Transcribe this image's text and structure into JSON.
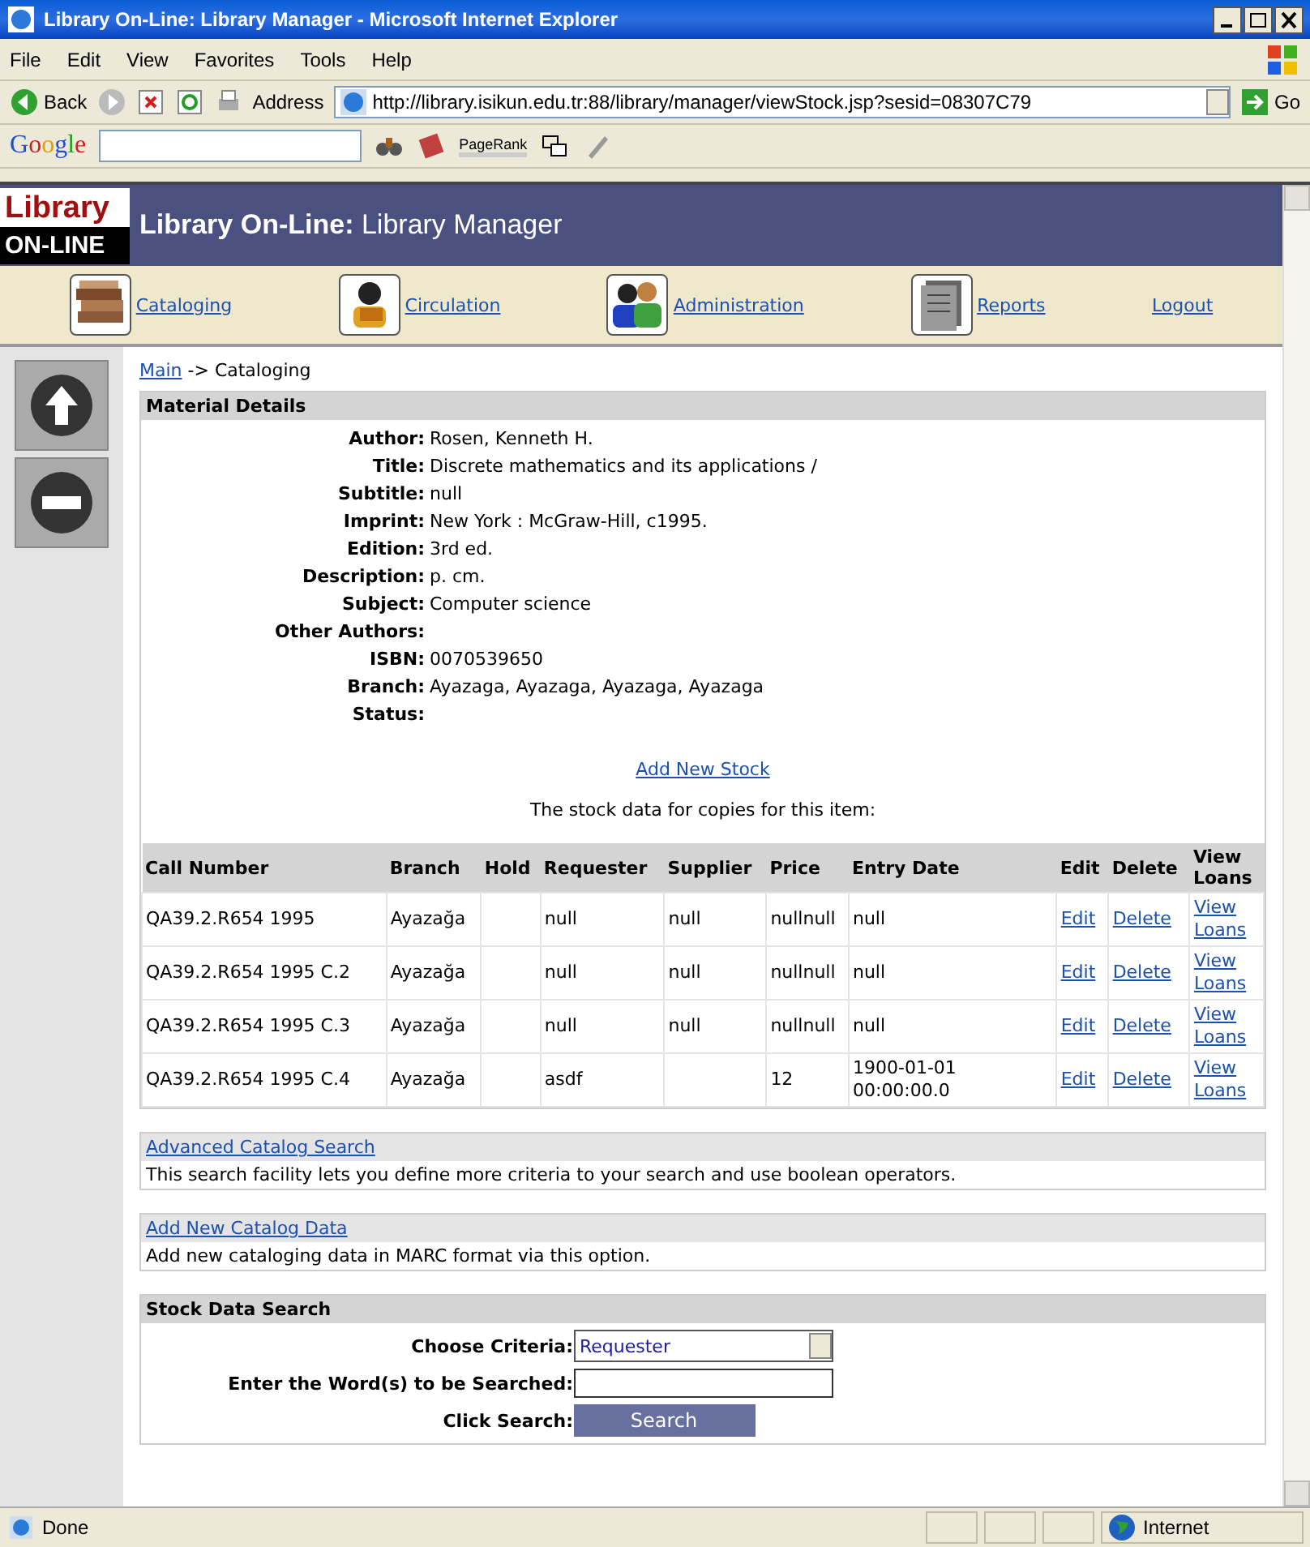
{
  "window": {
    "title": "Library On-Line: Library Manager - Microsoft Internet Explorer"
  },
  "menu": [
    "File",
    "Edit",
    "View",
    "Favorites",
    "Tools",
    "Help"
  ],
  "toolbar": {
    "back": "Back",
    "address_label": "Address",
    "url": "http://library.isikun.edu.tr:88/library/manager/viewStock.jsp?sesid=08307C79",
    "go": "Go"
  },
  "google_bar": {
    "logo": "Google",
    "pagerank": "PageRank"
  },
  "header": {
    "logo_top": "Library",
    "logo_bottom": "ON-LINE",
    "title_bold": "Library On-Line:",
    "title": "Library Manager"
  },
  "nav": [
    {
      "label": "Cataloging",
      "kind": "books"
    },
    {
      "label": "Circulation",
      "kind": "reader"
    },
    {
      "label": "Administration",
      "kind": "people"
    },
    {
      "label": "Reports",
      "kind": "document"
    },
    {
      "label": "Logout",
      "kind": "plain"
    }
  ],
  "breadcrumb": {
    "link": "Main",
    "rest": "-> Cataloging"
  },
  "material": {
    "heading": "Material Details",
    "fields": [
      {
        "label": "Author:",
        "value": "Rosen, Kenneth H."
      },
      {
        "label": "Title:",
        "value": "Discrete mathematics and its applications /"
      },
      {
        "label": "Subtitle:",
        "value": "null"
      },
      {
        "label": "Imprint:",
        "value": "New York : McGraw-Hill, c1995."
      },
      {
        "label": "Edition:",
        "value": "3rd ed."
      },
      {
        "label": "Description:",
        "value": "p. cm."
      },
      {
        "label": "Subject:",
        "value": "Computer science"
      },
      {
        "label": "Other Authors:"
      },
      {
        "label": "ISBN:",
        "value": "0070539650"
      },
      {
        "label": "Branch:",
        "value": "Ayazaga, Ayazaga, Ayazaga, Ayazaga"
      },
      {
        "label": "Status:"
      }
    ],
    "add_stock": "Add New Stock",
    "stock_note": "The stock data for copies for this item:"
  },
  "stock_table": {
    "columns": [
      "Call Number",
      "Branch",
      "Hold",
      "Requester",
      "Supplier",
      "Price",
      "Entry Date",
      "Edit",
      "Delete",
      "View Loans"
    ],
    "rows": [
      {
        "call_number": "QA39.2.R654 1995",
        "branch": "Ayazağa",
        "requester": "null",
        "supplier": "null",
        "price": "nullnull",
        "entry_date": "null",
        "actions": [
          "Edit",
          "Delete",
          "View Loans"
        ]
      },
      {
        "call_number": "QA39.2.R654 1995 C.2",
        "branch": "Ayazağa",
        "requester": "null",
        "supplier": "null",
        "price": "nullnull",
        "entry_date": "null",
        "actions": [
          "Edit",
          "Delete",
          "View Loans"
        ]
      },
      {
        "call_number": "QA39.2.R654 1995 C.3",
        "branch": "Ayazağa",
        "requester": "null",
        "supplier": "null",
        "price": "nullnull",
        "entry_date": "null",
        "actions": [
          "Edit",
          "Delete",
          "View Loans"
        ]
      },
      {
        "call_number": "QA39.2.R654 1995 C.4",
        "branch": "Ayazağa",
        "requester": "asdf",
        "price": "12",
        "entry_date": "1900-01-01 00:00:00.0",
        "actions": [
          "Edit",
          "Delete",
          "View Loans"
        ]
      }
    ]
  },
  "links": [
    {
      "title": "Advanced Catalog Search",
      "text": "This search facility lets you define more criteria to your search and use boolean operators."
    },
    {
      "title": "Add New Catalog Data",
      "text": "Add new cataloging data in MARC format via this option."
    }
  ],
  "stock_search": {
    "heading": "Stock Data Search",
    "criteria_label": "Choose Criteria:",
    "criteria": "Requester",
    "words_label": "Enter the Word(s) to be Searched:",
    "click_label": "Click Search:",
    "button": "Search"
  },
  "status_bar": {
    "text": "Done",
    "zone": "Internet"
  }
}
